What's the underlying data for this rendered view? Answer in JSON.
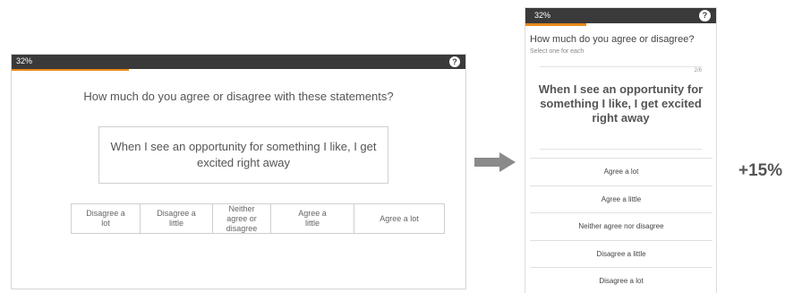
{
  "desktop": {
    "progress_text": "32%",
    "progress_value": 0.32,
    "help_icon": "?",
    "question": "How much do you agree or disagree with these statements?",
    "statement": "When I see an opportunity for something I like, I get excited right away",
    "scale": [
      "Disagree a lot",
      "Disagree a little",
      "Neither agree or disagree",
      "Agree a little",
      "Agree a lot"
    ]
  },
  "mobile": {
    "progress_text": "32%",
    "progress_value": 0.32,
    "help_icon": "?",
    "question": "How much do you agree or disagree?",
    "hint": "Select one for each",
    "counter": "2/6",
    "statement": "When I see an opportunity for something I like, I get excited right away",
    "options": [
      "Agree a lot",
      "Agree a little",
      "Neither agree nor disagree",
      "Disagree a little",
      "Disagree a lot"
    ]
  },
  "arrow_icon": "right-arrow-icon",
  "uplift": "+15%",
  "colors": {
    "topbar": "#3a3a3a",
    "progress": "#e8891a",
    "arrow": "#8a8a8a"
  }
}
